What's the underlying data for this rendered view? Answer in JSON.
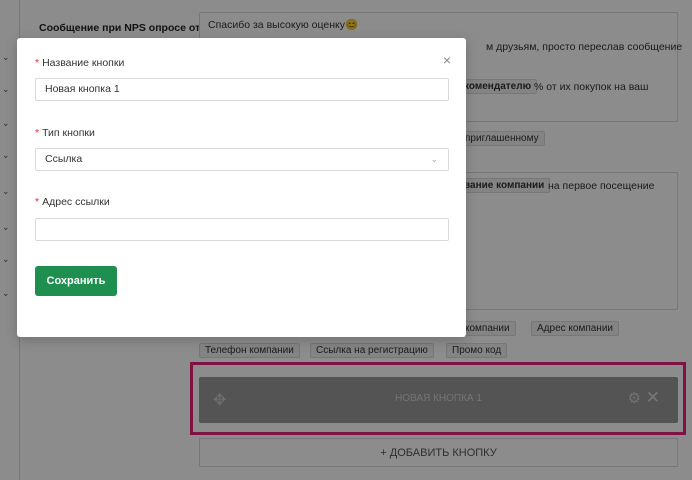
{
  "background": {
    "nps_label": "Сообщение при NPS опросе от",
    "textarea1_lines": [
      "Спасибо за высокую оценку😊",
      "м друзьям, просто переслав сообщение",
      "% от их покупок на ваш"
    ],
    "tag_recommender": "комендателю",
    "tag_invited": "приглашенному",
    "tag_company_name": "вание компании",
    "textarea2_line": "на первое посещение",
    "tag_company": "компании",
    "tag_company_address": "Адрес компании",
    "tag_company_phone": "Телефон компании",
    "tag_registration_link": "Ссылка на регистрацию",
    "tag_promo_code": "Промо код",
    "button_card_label": "НОВАЯ КНОПКА 1",
    "add_button_label": "+ ДОБАВИТЬ КНОПКУ",
    "accent_color": "#e8207e"
  },
  "modal": {
    "close_glyph": "×",
    "button_name_label": "Название кнопки",
    "button_name_value": "Новая кнопка 1",
    "button_type_label": "Тип кнопки",
    "button_type_value": "Ссылка",
    "link_address_label": "Адрес ссылки",
    "link_address_value": "",
    "required_mark": "*",
    "save_label": "Сохранить",
    "save_color": "#1e8f4e"
  }
}
